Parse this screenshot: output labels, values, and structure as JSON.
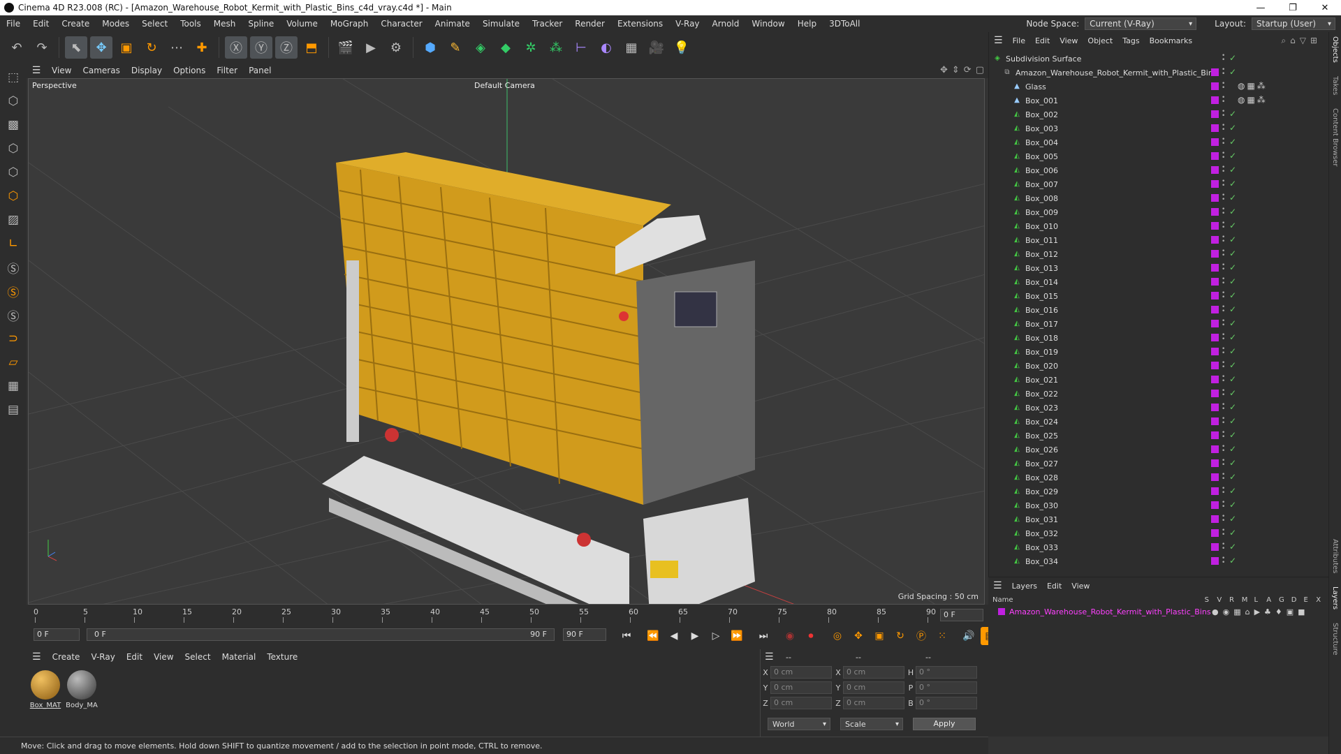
{
  "window": {
    "title": "Cinema 4D R23.008 (RC) - [Amazon_Warehouse_Robot_Kermit_with_Plastic_Bins_c4d_vray.c4d *] - Main"
  },
  "menu": [
    "File",
    "Edit",
    "Create",
    "Modes",
    "Select",
    "Tools",
    "Mesh",
    "Spline",
    "Volume",
    "MoGraph",
    "Character",
    "Animate",
    "Simulate",
    "Tracker",
    "Render",
    "Extensions",
    "V-Ray",
    "Arnold",
    "Window",
    "Help",
    "3DToAll"
  ],
  "nodespace": {
    "label": "Node Space:",
    "value": "Current (V-Ray)"
  },
  "layout": {
    "label": "Layout:",
    "value": "Startup (User)"
  },
  "viewport": {
    "menu": [
      "View",
      "Cameras",
      "Display",
      "Options",
      "Filter",
      "Panel"
    ],
    "view_name": "Perspective",
    "camera": "Default Camera",
    "grid_spacing": "Grid Spacing : 50 cm"
  },
  "timeline": {
    "ticks": [
      "0",
      "5",
      "10",
      "15",
      "20",
      "25",
      "30",
      "35",
      "40",
      "45",
      "50",
      "55",
      "60",
      "65",
      "70",
      "75",
      "80",
      "85",
      "90"
    ],
    "current_frame": "0 F",
    "start": "0 F",
    "range_start": "0 F",
    "range_end": "90 F",
    "end": "90 F"
  },
  "material_panel": {
    "menu": [
      "Create",
      "V-Ray",
      "Edit",
      "View",
      "Select",
      "Material",
      "Texture"
    ],
    "materials": [
      {
        "name": "Box_MAT",
        "color": "#c08a20"
      },
      {
        "name": "Body_MA",
        "color": "#777777"
      }
    ]
  },
  "coordinates": {
    "header": [
      "--",
      "--",
      "--"
    ],
    "rows": [
      {
        "a": "X",
        "av": "0 cm",
        "b": "X",
        "bv": "0 cm",
        "c": "H",
        "cv": "0 °"
      },
      {
        "a": "Y",
        "av": "0 cm",
        "b": "Y",
        "bv": "0 cm",
        "c": "P",
        "cv": "0 °"
      },
      {
        "a": "Z",
        "av": "0 cm",
        "b": "Z",
        "bv": "0 cm",
        "c": "B",
        "cv": "0 °"
      }
    ],
    "mode1": "World",
    "mode2": "Scale",
    "apply": "Apply"
  },
  "status": "Move: Click and drag to move elements. Hold down SHIFT to quantize movement / add to the selection in point mode, CTRL to remove.",
  "objects_panel": {
    "menu": [
      "File",
      "Edit",
      "View",
      "Object",
      "Tags",
      "Bookmarks"
    ],
    "items": [
      "Subdivision Surface",
      "Amazon_Warehouse_Robot_Kermit_with_Plastic_Bins",
      "Glass",
      "Box_001",
      "Box_002",
      "Box_003",
      "Box_004",
      "Box_005",
      "Box_006",
      "Box_007",
      "Box_008",
      "Box_009",
      "Box_010",
      "Box_011",
      "Box_012",
      "Box_013",
      "Box_014",
      "Box_015",
      "Box_016",
      "Box_017",
      "Box_018",
      "Box_019",
      "Box_020",
      "Box_021",
      "Box_022",
      "Box_023",
      "Box_024",
      "Box_025",
      "Box_026",
      "Box_027",
      "Box_028",
      "Box_029",
      "Box_030",
      "Box_031",
      "Box_032",
      "Box_033",
      "Box_034"
    ]
  },
  "layers_panel": {
    "menu": [
      "Layers",
      "Edit",
      "View"
    ],
    "col_name": "Name",
    "cols": [
      "S",
      "V",
      "R",
      "M",
      "L",
      "A",
      "G",
      "D",
      "E",
      "X"
    ],
    "layer": "Amazon_Warehouse_Robot_Kermit_with_Plastic_Bins"
  },
  "side_tabs": [
    "Objects",
    "Takes",
    "Content Browser",
    "Attributes",
    "Layers",
    "Structure"
  ]
}
